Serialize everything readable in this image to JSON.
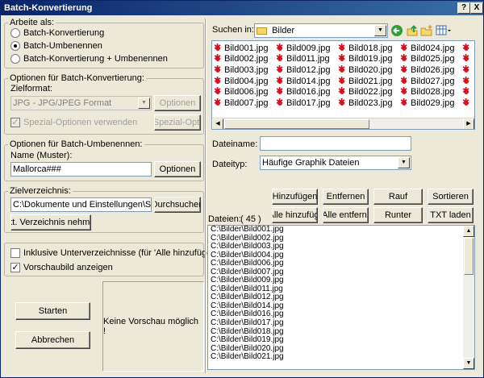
{
  "window": {
    "title": "Batch-Konvertierung"
  },
  "titlebar_buttons": {
    "help": "?",
    "close": "X"
  },
  "mode": {
    "legend": "Arbeite als:",
    "options": [
      "Batch-Konvertierung",
      "Batch-Umbenennen",
      "Batch-Konvertierung + Umbenennen"
    ],
    "selected": 1
  },
  "convert": {
    "legend": "Optionen für Batch-Konvertierung:",
    "format_label": "Zielformat:",
    "format_value": "JPG - JPG/JPEG Format",
    "options_button": "Optionen",
    "special_checkbox": "Spezial-Optionen verwenden",
    "special_button": "Spezial-Opt."
  },
  "rename": {
    "legend": "Optionen für Batch-Umbenennen:",
    "name_label": "Name (Muster):",
    "name_value": "Mallorca###",
    "options_button": "Optionen"
  },
  "target": {
    "legend": "Zielverzeichnis:",
    "path_value": "C:\\Dokumente und Einstellungen\\Scandig\\",
    "browse_button": "Durchsuchen",
    "current_button": "Akt. Verzeichnis nehmen"
  },
  "include_subdirs": {
    "label": "Inklusive Unterverzeichnisse (für 'Alle hinzufügen')",
    "checked": false
  },
  "show_preview": {
    "label": "Vorschaubild anzeigen",
    "checked": true
  },
  "start_button": "Starten",
  "cancel_button": "Abbrechen",
  "preview_text": "Keine Vorschau möglich !",
  "browser": {
    "look_in_label": "Suchen in:",
    "folder": "Bilder",
    "files": [
      "Bild001.jpg",
      "Bild002.jpg",
      "Bild003.jpg",
      "Bild004.jpg",
      "Bild006.jpg",
      "Bild007.jpg",
      "Bild009.jpg",
      "Bild011.jpg",
      "Bild012.jpg",
      "Bild014.jpg",
      "Bild016.jpg",
      "Bild017.jpg",
      "Bild018.jpg",
      "Bild019.jpg",
      "Bild020.jpg",
      "Bild021.jpg",
      "Bild022.jpg",
      "Bild023.jpg",
      "Bild024.jpg",
      "Bild025.jpg",
      "Bild026.jpg",
      "Bild027.jpg",
      "Bild028.jpg",
      "Bild029.jpg"
    ],
    "filename_label": "Dateiname:",
    "filename_value": "",
    "filetype_label": "Dateityp:",
    "filetype_value": "Häufige Graphik Dateien"
  },
  "actions": {
    "add": "Hinzufügen",
    "remove": "Entfernen",
    "up": "Rauf",
    "sort": "Sortieren",
    "add_all": "Alle hinzufüg.",
    "remove_all": "Alle entfern.",
    "down": "Runter",
    "load_txt": "TXT laden"
  },
  "filelist": {
    "label": "Dateien:",
    "count": "( 45 )",
    "items": [
      "C:\\Bilder\\Bild001.jpg",
      "C:\\Bilder\\Bild002.jpg",
      "C:\\Bilder\\Bild003.jpg",
      "C:\\Bilder\\Bild004.jpg",
      "C:\\Bilder\\Bild006.jpg",
      "C:\\Bilder\\Bild007.jpg",
      "C:\\Bilder\\Bild009.jpg",
      "C:\\Bilder\\Bild011.jpg",
      "C:\\Bilder\\Bild012.jpg",
      "C:\\Bilder\\Bild014.jpg",
      "C:\\Bilder\\Bild016.jpg",
      "C:\\Bilder\\Bild017.jpg",
      "C:\\Bilder\\Bild018.jpg",
      "C:\\Bilder\\Bild019.jpg",
      "C:\\Bilder\\Bild020.jpg",
      "C:\\Bilder\\Bild021.jpg"
    ]
  }
}
